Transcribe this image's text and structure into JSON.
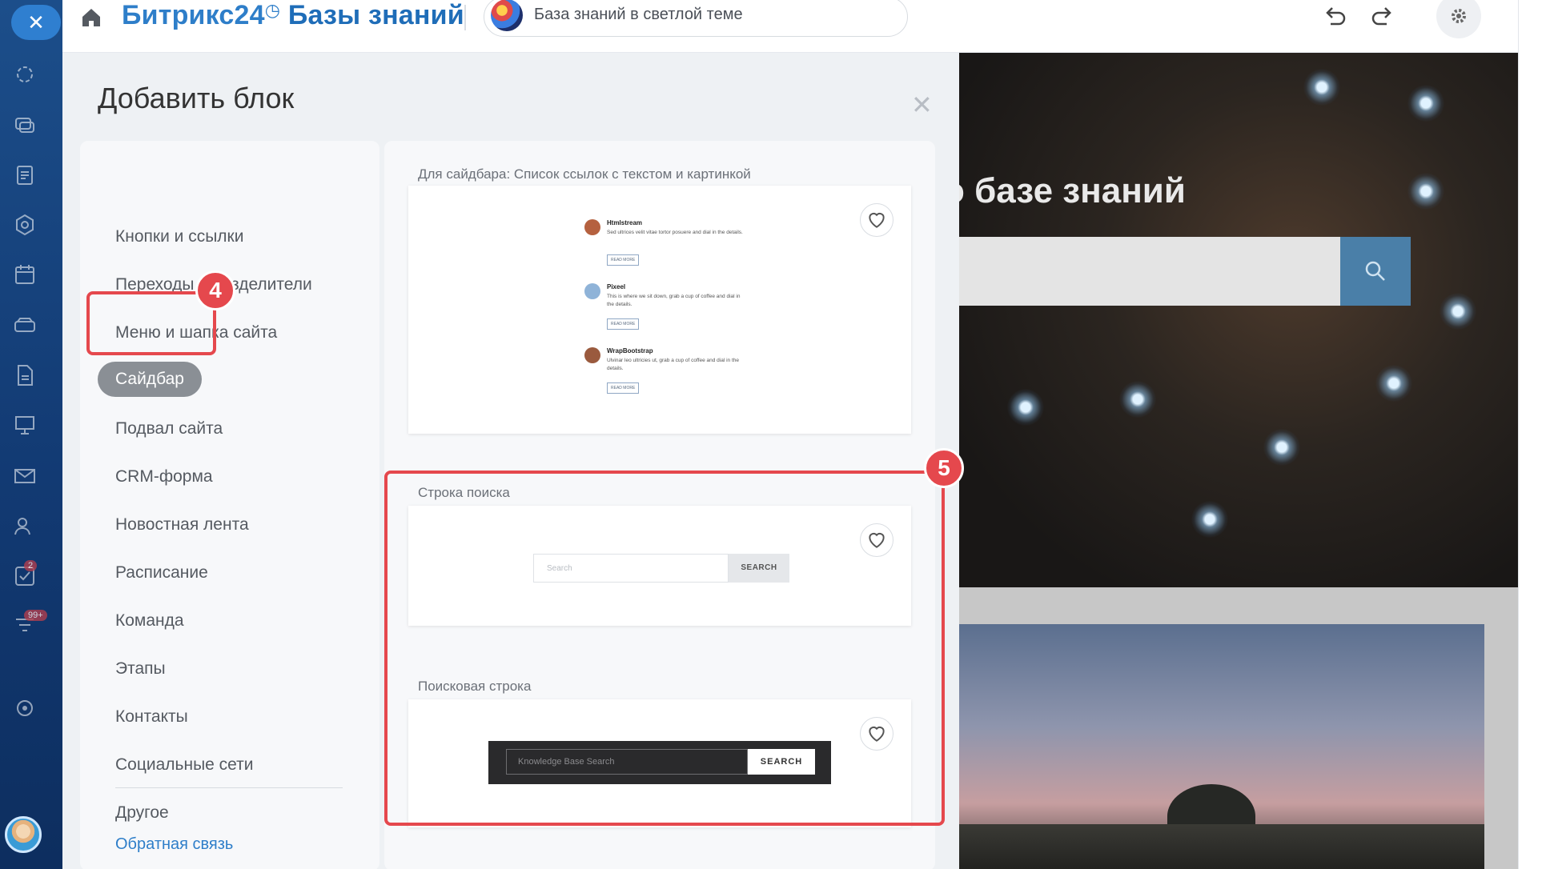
{
  "rail": {
    "close_icon": "close-icon",
    "icons": [
      "activity-icon",
      "chat-icon",
      "document-icon",
      "hexagon-icon",
      "calendar-icon",
      "drive-icon",
      "file-icon",
      "presentation-icon",
      "mail-icon",
      "people-icon",
      "tasks-icon",
      "filter-icon",
      "settings-icon"
    ],
    "tasks_badge": "2",
    "filter_badge": "99+"
  },
  "header": {
    "brand": "Битрикс24",
    "brand_suffix": "Базы знаний",
    "site_name": "База знаний в светлой теме"
  },
  "panel": {
    "title": "Добавить блок",
    "categories": [
      "Кнопки и ссылки",
      "Переходы и разделители",
      "Меню и шапка сайта",
      "Сайдбар",
      "Подвал сайта",
      "CRM-форма",
      "Новостная лента",
      "Расписание",
      "Команда",
      "Этапы",
      "Контакты",
      "Социальные сети",
      "Другое"
    ],
    "active_category": "Сайдбар",
    "feedback_link": "Обратная связь",
    "blocks": [
      {
        "title": "Для сайдбара: Список ссылок с текстом и картинкой",
        "items": [
          {
            "name": "Htmlstream",
            "text": "Sed ultrices velit vitae tortor posuere and dial in the details.",
            "button": "READ MORE"
          },
          {
            "name": "Pixeel",
            "text": "This is where we sit down, grab a cup of coffee and dial in the details.",
            "button": "READ MORE"
          },
          {
            "name": "WrapBootstrap",
            "text": "Ulvinar leo ultricies ut, grab a cup of coffee and dial in the details.",
            "button": "READ MORE"
          }
        ]
      },
      {
        "title": "Строка поиска",
        "placeholder": "Search",
        "button": "SEARCH"
      },
      {
        "title": "Поисковая строка",
        "placeholder": "Knowledge Base Search",
        "button": "SEARCH"
      }
    ]
  },
  "markers": {
    "step4": "4",
    "step5": "5"
  },
  "preview": {
    "hero_title": "о базе знаний"
  },
  "colors": {
    "accent": "#2e7ec9",
    "marker": "#e5484d",
    "rail": "#123a73"
  }
}
